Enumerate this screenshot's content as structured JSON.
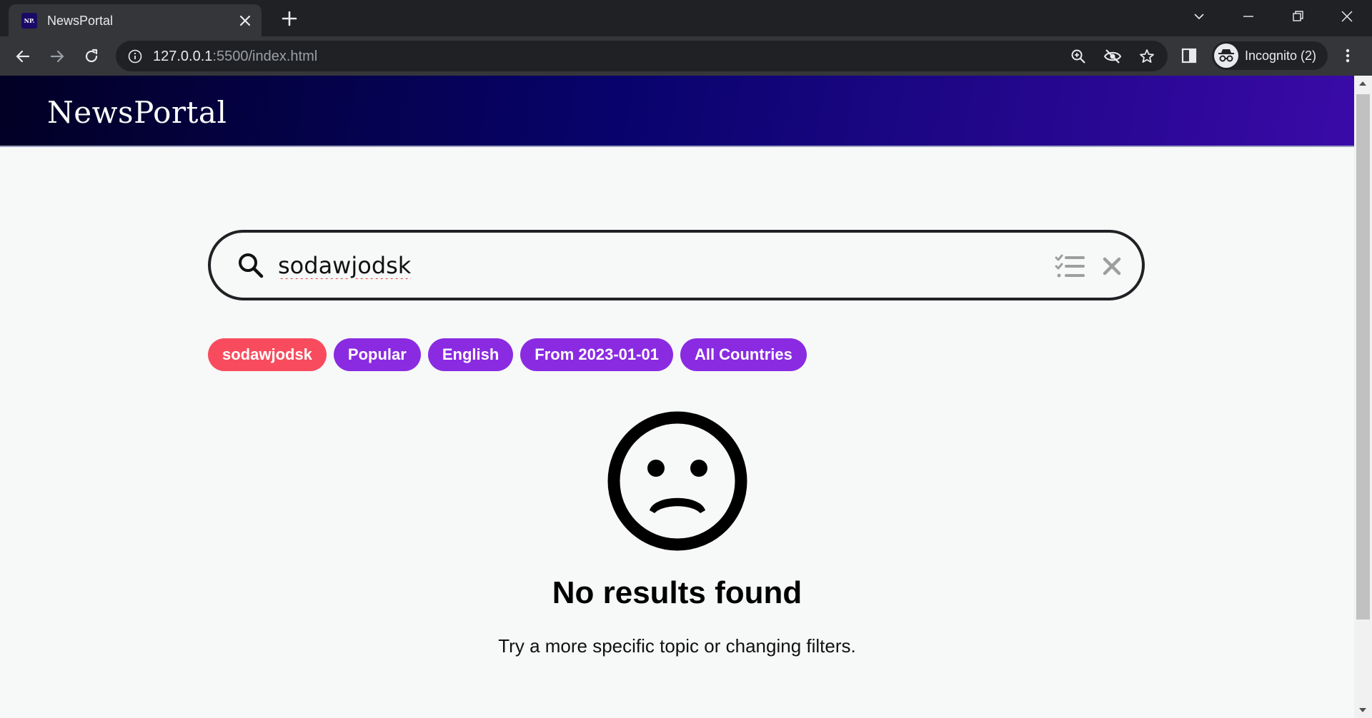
{
  "browser": {
    "tab": {
      "favicon_text": "NP.",
      "title": "NewsPortal"
    },
    "url": {
      "host": "127.0.0.1",
      "rest": ":5500/index.html"
    },
    "profile_label": "Incognito (2)"
  },
  "site": {
    "logo": "NewsPortal"
  },
  "search": {
    "value": "sodawjodsk"
  },
  "chips": {
    "query": "sodawjodsk",
    "sort": "Popular",
    "language": "English",
    "date": "From 2023-01-01",
    "country": "All Countries"
  },
  "empty_state": {
    "title": "No results found",
    "subtitle": "Try a more specific topic or changing filters."
  },
  "colors": {
    "chip_query": "#f84c5e",
    "chip_filter": "#8a2be2",
    "header_gradient_start": "#020024",
    "header_gradient_end": "#3a0aa8"
  }
}
